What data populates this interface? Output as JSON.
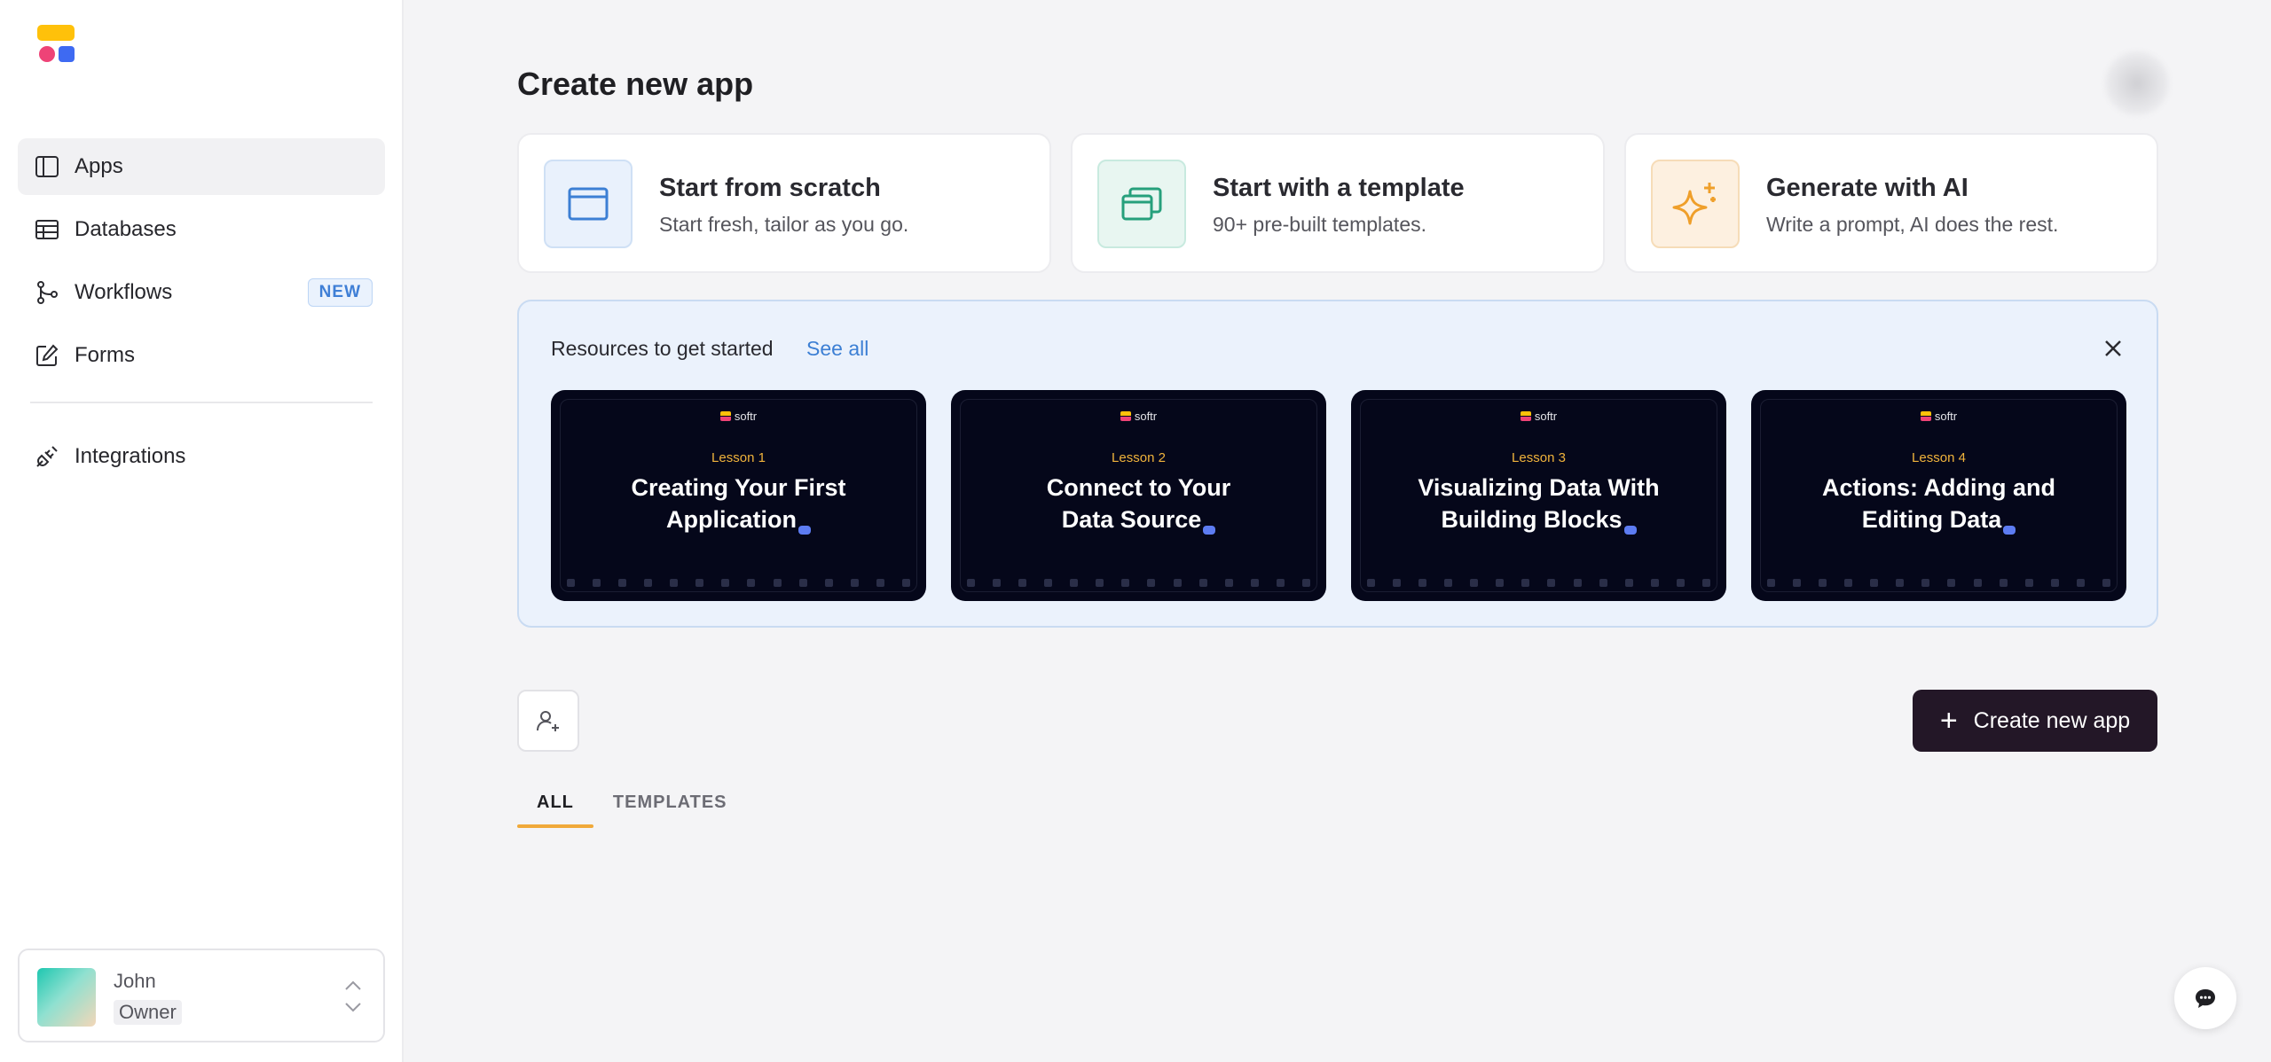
{
  "colors": {
    "logo_bar": "#FFC10A",
    "logo_dot_pink": "#EE4377",
    "logo_dot_blue": "#3E6AF2",
    "accent_tab": "#F0A93A",
    "primary_button": "#231727",
    "link": "#3C7FD4"
  },
  "sidebar": {
    "items": [
      {
        "label": "Apps",
        "icon": "sidebar-panel-icon",
        "active": true
      },
      {
        "label": "Databases",
        "icon": "table-icon"
      },
      {
        "label": "Workflows",
        "icon": "branch-icon",
        "badge": "NEW"
      },
      {
        "label": "Forms",
        "icon": "edit-form-icon"
      },
      {
        "label": "Integrations",
        "icon": "plug-icon"
      }
    ],
    "user": {
      "name": "John",
      "role": "Owner"
    }
  },
  "header": {
    "title": "Create new app"
  },
  "create_options": [
    {
      "title": "Start from scratch",
      "subtitle": "Start fresh, tailor as you go.",
      "icon": "window-icon"
    },
    {
      "title": "Start with a template",
      "subtitle": "90+ pre-built templates.",
      "icon": "stacked-windows-icon"
    },
    {
      "title": "Generate with AI",
      "subtitle": "Write a prompt, AI does the rest.",
      "icon": "sparkle-icon"
    }
  ],
  "resources": {
    "title": "Resources to get started",
    "see_all": "See all",
    "lessons": [
      {
        "brand": "softr",
        "number": "Lesson 1",
        "line1": "Creating Your First",
        "line2": "Application"
      },
      {
        "brand": "softr",
        "number": "Lesson 2",
        "line1": "Connect to Your",
        "line2": "Data Source"
      },
      {
        "brand": "softr",
        "number": "Lesson 3",
        "line1": "Visualizing Data With",
        "line2": "Building Blocks"
      },
      {
        "brand": "softr",
        "number": "Lesson 4",
        "line1": "Actions: Adding and",
        "line2": "Editing Data"
      }
    ]
  },
  "actions": {
    "create_button": "Create new app",
    "invite_icon": "add-user-icon"
  },
  "tabs": [
    "ALL",
    "TEMPLATES"
  ],
  "chat": {
    "icon": "chat-bubble-icon"
  }
}
